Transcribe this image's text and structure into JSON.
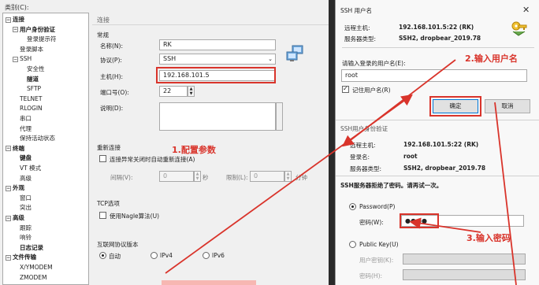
{
  "left": {
    "category_label": "类别(C):",
    "tree": [
      {
        "label": "连接",
        "level": 0,
        "bold": true,
        "exp": "−"
      },
      {
        "label": "用户身份验证",
        "level": 1,
        "bold": true,
        "exp": "−"
      },
      {
        "label": "登录提示符",
        "level": 2
      },
      {
        "label": "登录脚本",
        "level": 1
      },
      {
        "label": "SSH",
        "level": 1,
        "exp": "−"
      },
      {
        "label": "安全性",
        "level": 2
      },
      {
        "label": "隧道",
        "level": 2,
        "bold": true
      },
      {
        "label": "SFTP",
        "level": 2
      },
      {
        "label": "TELNET",
        "level": 1
      },
      {
        "label": "RLOGIN",
        "level": 1
      },
      {
        "label": "串口",
        "level": 1
      },
      {
        "label": "代理",
        "level": 1
      },
      {
        "label": "保持活动状态",
        "level": 1
      },
      {
        "label": "终端",
        "level": 0,
        "bold": true,
        "exp": "−"
      },
      {
        "label": "键盘",
        "level": 1,
        "bold": true
      },
      {
        "label": "VT 模式",
        "level": 1
      },
      {
        "label": "高级",
        "level": 1
      },
      {
        "label": "外观",
        "level": 0,
        "bold": true,
        "exp": "−"
      },
      {
        "label": "窗口",
        "level": 1
      },
      {
        "label": "突出",
        "level": 1
      },
      {
        "label": "高级",
        "level": 0,
        "bold": true,
        "exp": "−"
      },
      {
        "label": "跟踪",
        "level": 1
      },
      {
        "label": "响铃",
        "level": 1
      },
      {
        "label": "日志记录",
        "level": 1,
        "bold": true
      },
      {
        "label": "文件传输",
        "level": 0,
        "bold": true,
        "exp": "−"
      },
      {
        "label": "X/YMODEM",
        "level": 1
      },
      {
        "label": "ZMODEM",
        "level": 1
      }
    ],
    "panel_title": "连接",
    "general": {
      "section": "常规",
      "name_label": "名称(N):",
      "name_value": "RK",
      "protocol_label": "协议(P):",
      "protocol_value": "SSH",
      "host_label": "主机(H):",
      "host_value": "192.168.101.5",
      "port_label": "端口号(O):",
      "port_value": "22",
      "desc_label": "说明(D):"
    },
    "reconnect": {
      "section": "重新连接",
      "auto_label": "连接异常关闭时自动重新连接(A)",
      "interval_label": "间隔(V):",
      "interval_value": "0",
      "interval_unit": "秒",
      "limit_label": "限制(L):",
      "limit_value": "0",
      "limit_unit": "分钟"
    },
    "tcp": {
      "section": "TCP选项",
      "nagle_label": "使用Nagle算法(U)"
    },
    "ipver": {
      "section": "互联网协议版本",
      "options": [
        "自动",
        "IPv4",
        "IPv6"
      ]
    },
    "annotation": "1.配置参数"
  },
  "dialog": {
    "title": "SSH 用户名",
    "close": "✕",
    "remote_host_label": "远程主机:",
    "remote_host_value": "192.168.101.5:22 (RK)",
    "server_type_label": "服务器类型:",
    "server_type_value": "SSH2, dropbear_2019.78",
    "prompt": "请输入登录的用户名(E):",
    "username_value": "root",
    "remember_label": "记住用户名(R)",
    "ok_label": "确定",
    "cancel_label": "取消",
    "annotation2": "2.输入用户名",
    "auth_title": "SSH用户身份验证",
    "remote_host_label2": "远程主机:",
    "remote_host_value2": "192.168.101.5:22 (RK)",
    "login_name_label": "登录名:",
    "login_name_value": "root",
    "server_type_label2": "服务器类型:",
    "server_type_value2": "SSH2, dropbear_2019.78",
    "reject_msg": "SSH服务器拒绝了密码。请再试一次。",
    "password_radio": "Password(P)",
    "password_label": "密码(W):",
    "password_value": "●●●●",
    "pubkey_radio": "Public Key(U)",
    "user_key_label": "用户密钥(K):",
    "passphrase_label": "密码(H):",
    "annotation3": "3.输入密码"
  },
  "colors": {
    "annotation_red": "#d9342b",
    "selected_blue": "#cde3f7"
  }
}
